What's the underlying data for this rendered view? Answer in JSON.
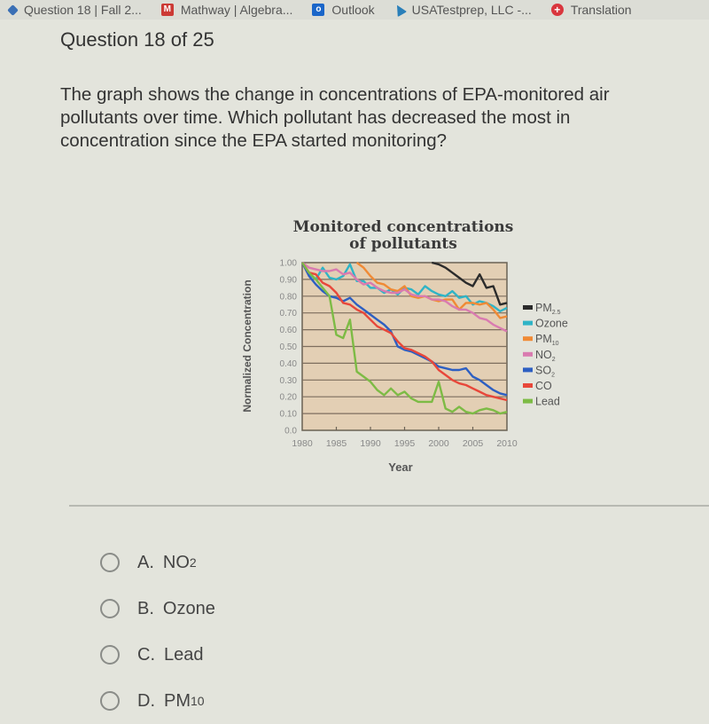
{
  "bookmarks": [
    {
      "icon": "drop-icon",
      "label": "Question 18 | Fall 2..."
    },
    {
      "icon": "mathway-icon",
      "label": "Mathway | Algebra..."
    },
    {
      "icon": "outlook-icon",
      "label": "Outlook"
    },
    {
      "icon": "usatestprep-icon",
      "label": "USATestprep, LLC -..."
    },
    {
      "icon": "translation-icon",
      "label": "Translation"
    }
  ],
  "question": {
    "number_label": "Question 18 of 25",
    "text": "The graph shows the change in concentrations of EPA-monitored air pollutants over time. Which pollutant has decreased the most in concentration since the EPA started monitoring?"
  },
  "options": [
    {
      "letter": "A.",
      "text": "NO",
      "sub": "2"
    },
    {
      "letter": "B.",
      "text": "Ozone",
      "sub": ""
    },
    {
      "letter": "C.",
      "text": "Lead",
      "sub": ""
    },
    {
      "letter": "D.",
      "text": "PM",
      "sub": "10"
    }
  ],
  "chart_data": {
    "type": "line",
    "title": "Monitored concentrations of pollutants",
    "title_lines": [
      "Monitored concentrations",
      "of pollutants"
    ],
    "xlabel": "Year",
    "ylabel": "Normalized Concentration",
    "xlim": [
      1980,
      2010
    ],
    "ylim": [
      0,
      1.0
    ],
    "xticks": [
      1980,
      1985,
      1990,
      1995,
      2000,
      2005,
      2010
    ],
    "yticks": [
      0.0,
      0.1,
      0.2,
      0.3,
      0.4,
      0.5,
      0.6,
      0.7,
      0.8,
      0.9,
      1.0
    ],
    "ytick_labels": [
      "0.0",
      "0.10",
      "0.20",
      "0.30",
      "0.40",
      "0.50",
      "0.60",
      "0.70",
      "0.80",
      "0.90",
      "1.00"
    ],
    "grid": true,
    "legend_position": "right",
    "series": [
      {
        "name": "PM2.5",
        "label": "PM",
        "sub": "2.5",
        "color": "#2b2b2b",
        "x": [
          1999,
          2000,
          2001,
          2002,
          2003,
          2004,
          2005,
          2006,
          2007,
          2008,
          2009,
          2010
        ],
        "y": [
          1.0,
          0.99,
          0.97,
          0.94,
          0.91,
          0.88,
          0.86,
          0.93,
          0.85,
          0.86,
          0.75,
          0.76
        ]
      },
      {
        "name": "Ozone",
        "label": "Ozone",
        "sub": "",
        "color": "#2fb4c6",
        "x": [
          1980,
          1981,
          1982,
          1983,
          1984,
          1985,
          1986,
          1987,
          1988,
          1989,
          1990,
          1991,
          1992,
          1993,
          1994,
          1995,
          1996,
          1997,
          1998,
          1999,
          2000,
          2001,
          2002,
          2003,
          2004,
          2005,
          2006,
          2007,
          2008,
          2009,
          2010
        ],
        "y": [
          1.0,
          0.93,
          0.9,
          0.97,
          0.91,
          0.9,
          0.92,
          0.99,
          0.89,
          0.89,
          0.85,
          0.85,
          0.82,
          0.84,
          0.81,
          0.85,
          0.84,
          0.81,
          0.86,
          0.83,
          0.81,
          0.8,
          0.83,
          0.79,
          0.8,
          0.75,
          0.77,
          0.76,
          0.74,
          0.71,
          0.73
        ]
      },
      {
        "name": "PM10",
        "label": "PM",
        "sub": "10",
        "color": "#f08a35",
        "x": [
          1988,
          1989,
          1990,
          1991,
          1992,
          1993,
          1994,
          1995,
          1996,
          1997,
          1998,
          1999,
          2000,
          2001,
          2002,
          2003,
          2004,
          2005,
          2006,
          2007,
          2008,
          2009,
          2010
        ],
        "y": [
          1.0,
          0.97,
          0.92,
          0.88,
          0.87,
          0.84,
          0.83,
          0.86,
          0.8,
          0.79,
          0.8,
          0.78,
          0.77,
          0.78,
          0.78,
          0.72,
          0.76,
          0.76,
          0.75,
          0.76,
          0.72,
          0.67,
          0.68
        ]
      },
      {
        "name": "NO2",
        "label": "NO",
        "sub": "2",
        "color": "#d97bb0",
        "x": [
          1980,
          1981,
          1982,
          1983,
          1984,
          1985,
          1986,
          1987,
          1988,
          1989,
          1990,
          1991,
          1992,
          1993,
          1994,
          1995,
          1996,
          1997,
          1998,
          1999,
          2000,
          2001,
          2002,
          2003,
          2004,
          2005,
          2006,
          2007,
          2008,
          2009,
          2010
        ],
        "y": [
          1.0,
          0.97,
          0.96,
          0.95,
          0.95,
          0.96,
          0.93,
          0.94,
          0.9,
          0.87,
          0.88,
          0.85,
          0.83,
          0.82,
          0.82,
          0.84,
          0.81,
          0.8,
          0.8,
          0.78,
          0.78,
          0.77,
          0.74,
          0.72,
          0.72,
          0.7,
          0.67,
          0.66,
          0.63,
          0.61,
          0.59
        ]
      },
      {
        "name": "SO2",
        "label": "SO",
        "sub": "2",
        "color": "#2d5fc2",
        "x": [
          1980,
          1981,
          1982,
          1983,
          1984,
          1985,
          1986,
          1987,
          1988,
          1989,
          1990,
          1991,
          1992,
          1993,
          1994,
          1995,
          1996,
          1997,
          1998,
          1999,
          2000,
          2001,
          2002,
          2003,
          2004,
          2005,
          2006,
          2007,
          2008,
          2009,
          2010
        ],
        "y": [
          1.0,
          0.92,
          0.87,
          0.83,
          0.8,
          0.79,
          0.77,
          0.79,
          0.75,
          0.72,
          0.69,
          0.66,
          0.63,
          0.59,
          0.5,
          0.48,
          0.47,
          0.45,
          0.43,
          0.41,
          0.38,
          0.37,
          0.36,
          0.36,
          0.37,
          0.32,
          0.3,
          0.27,
          0.24,
          0.22,
          0.21
        ]
      },
      {
        "name": "CO",
        "label": "CO",
        "sub": "",
        "color": "#e8473a",
        "x": [
          1980,
          1981,
          1982,
          1983,
          1984,
          1985,
          1986,
          1987,
          1988,
          1989,
          1990,
          1991,
          1992,
          1993,
          1994,
          1995,
          1996,
          1997,
          1998,
          1999,
          2000,
          2001,
          2002,
          2003,
          2004,
          2005,
          2006,
          2007,
          2008,
          2009,
          2010
        ],
        "y": [
          1.0,
          0.94,
          0.93,
          0.88,
          0.86,
          0.82,
          0.76,
          0.75,
          0.72,
          0.7,
          0.66,
          0.62,
          0.6,
          0.58,
          0.53,
          0.49,
          0.48,
          0.46,
          0.44,
          0.41,
          0.36,
          0.33,
          0.3,
          0.28,
          0.27,
          0.25,
          0.23,
          0.21,
          0.2,
          0.19,
          0.18
        ]
      },
      {
        "name": "Lead",
        "label": "Lead",
        "sub": "",
        "color": "#7dbb45",
        "x": [
          1980,
          1981,
          1982,
          1983,
          1984,
          1985,
          1986,
          1987,
          1988,
          1989,
          1990,
          1991,
          1992,
          1993,
          1994,
          1995,
          1996,
          1997,
          1998,
          1999,
          2000,
          2001,
          2002,
          2003,
          2004,
          2005,
          2006,
          2007,
          2008,
          2009,
          2010
        ],
        "y": [
          1.0,
          0.94,
          0.9,
          0.85,
          0.8,
          0.57,
          0.55,
          0.66,
          0.35,
          0.32,
          0.29,
          0.24,
          0.21,
          0.25,
          0.21,
          0.23,
          0.19,
          0.17,
          0.17,
          0.17,
          0.29,
          0.13,
          0.11,
          0.14,
          0.11,
          0.1,
          0.12,
          0.13,
          0.12,
          0.1,
          0.11
        ]
      }
    ]
  }
}
